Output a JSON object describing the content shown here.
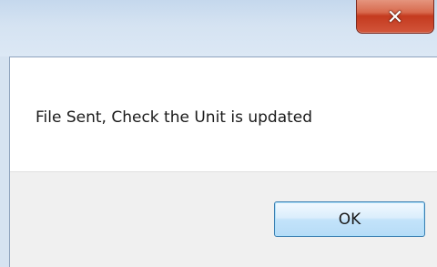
{
  "window": {
    "close_icon": "close-icon"
  },
  "dialog": {
    "message": "File Sent, Check the Unit is updated",
    "ok_label": "OK"
  },
  "colors": {
    "close_button": "#c43a1f",
    "ok_border": "#3c7fb1",
    "content_bg": "#ffffff",
    "footer_bg": "#f0f0f0"
  }
}
